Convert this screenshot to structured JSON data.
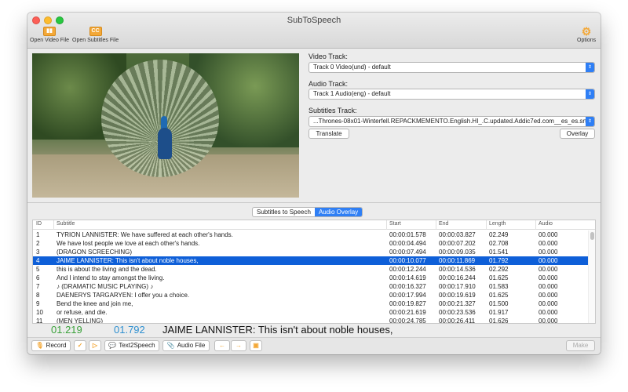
{
  "window": {
    "title": "SubToSpeech"
  },
  "toolbar": {
    "open_video": {
      "label": "Open Video File",
      "icon": "film-icon"
    },
    "open_subtitles": {
      "label": "Open Subtitles File",
      "icon": "cc-icon",
      "glyph": "CC"
    },
    "options": {
      "label": "Options",
      "icon": "gear-icon"
    }
  },
  "tracks": {
    "video_label": "Video Track:",
    "video_value": "Track 0 Video(und) - default",
    "audio_label": "Audio Track:",
    "audio_value": "Track 1 Audio(eng) - default",
    "subtitles_label": "Subtitles Track:",
    "subtitles_value": "...Thrones-08x01-Winterfell.REPACKMEMENTO.English.HI_.C.updated.Addic7ed.com__es_es.srt",
    "translate_button": "Translate",
    "overlay_button": "Overlay"
  },
  "tabs": [
    {
      "label": "Subtitles to Speech",
      "active": false
    },
    {
      "label": "Audio Overlay",
      "active": true
    }
  ],
  "table": {
    "columns": [
      "ID",
      "Subtitle",
      "Start",
      "End",
      "Length",
      "Audio"
    ],
    "rows": [
      {
        "id": "1",
        "subtitle": "TYRION LANNISTER: We have suffered at each other's hands.",
        "start": "00:00:01.578",
        "end": "00:00:03.827",
        "length": "02.249",
        "audio": "00.000",
        "selected": false
      },
      {
        "id": "2",
        "subtitle": "We have lost people we love at each other's hands.",
        "start": "00:00:04.494",
        "end": "00:00:07.202",
        "length": "02.708",
        "audio": "00.000",
        "selected": false
      },
      {
        "id": "3",
        "subtitle": "(DRAGON SCREECHING)",
        "start": "00:00:07.494",
        "end": "00:00:09.035",
        "length": "01.541",
        "audio": "00.000",
        "selected": false
      },
      {
        "id": "4",
        "subtitle": "JAIME LANNISTER: This isn't about noble houses,",
        "start": "00:00:10.077",
        "end": "00:00:11.869",
        "length": "01.792",
        "audio": "00.000",
        "selected": true
      },
      {
        "id": "5",
        "subtitle": "this is about the living and the dead.",
        "start": "00:00:12.244",
        "end": "00:00:14.536",
        "length": "02.292",
        "audio": "00.000",
        "selected": false
      },
      {
        "id": "6",
        "subtitle": "And I intend to stay amongst the living.",
        "start": "00:00:14.619",
        "end": "00:00:16.244",
        "length": "01.625",
        "audio": "00.000",
        "selected": false
      },
      {
        "id": "7",
        "subtitle": "♪ (DRAMATIC MUSIC PLAYING) ♪",
        "start": "00:00:16.327",
        "end": "00:00:17.910",
        "length": "01.583",
        "audio": "00.000",
        "selected": false
      },
      {
        "id": "8",
        "subtitle": "DAENERYS TARGARYEN: I offer you a choice.",
        "start": "00:00:17.994",
        "end": "00:00:19.619",
        "length": "01.625",
        "audio": "00.000",
        "selected": false
      },
      {
        "id": "9",
        "subtitle": "Bend the knee and join me,",
        "start": "00:00:19.827",
        "end": "00:00:21.327",
        "length": "01.500",
        "audio": "00.000",
        "selected": false
      },
      {
        "id": "10",
        "subtitle": "or refuse, and die.",
        "start": "00:00:21.619",
        "end": "00:00:23.536",
        "length": "01.917",
        "audio": "00.000",
        "selected": false
      },
      {
        "id": "11",
        "subtitle": "(MEN YELLING)",
        "start": "00:00:24.785",
        "end": "00:00:26.411",
        "length": "01.626",
        "audio": "00.000",
        "selected": false
      }
    ]
  },
  "current_subtitle": {
    "start": "01.219",
    "length": "01.792",
    "text": "JAIME LANNISTER: This isn't about noble houses,"
  },
  "bottom_toolbar": {
    "record": "Record",
    "text2speech": "Text2Speech",
    "audio_file": "Audio File",
    "make": "Make"
  },
  "colors": {
    "accent": "#2f7ff5",
    "selection": "#0e5fd8",
    "start_green": "#3aa13a",
    "length_blue": "#2d8fd0",
    "toolbar_orange": "#f3a838"
  }
}
